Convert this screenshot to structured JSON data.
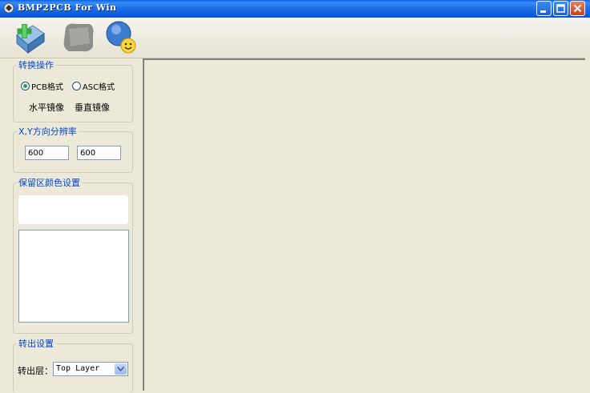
{
  "window": {
    "title": "BMP2PCB For Win"
  },
  "toolbar": {
    "tools": [
      "open-icon",
      "bitmap-icon",
      "about-icon"
    ]
  },
  "convert_group": {
    "legend": "转换操作",
    "options": [
      {
        "label": "PCB格式",
        "checked": true
      },
      {
        "label": "ASC格式",
        "checked": false
      }
    ],
    "mirror_horizontal": "水平镜像",
    "mirror_vertical": "垂直镜像"
  },
  "resolution_group": {
    "legend": "X,Y方向分辨率",
    "x_value": "600",
    "y_value": "600"
  },
  "color_group": {
    "legend": "保留区颜色设置"
  },
  "output_group": {
    "legend": "转出设置",
    "layer_label": "转出层：",
    "layer_value": "Top  Layer"
  },
  "colors": {
    "titlebar": "#0A5FE8",
    "window_bg": "#ECE9D8",
    "legend_text": "#0046D5",
    "close_button": "#C8401F"
  }
}
